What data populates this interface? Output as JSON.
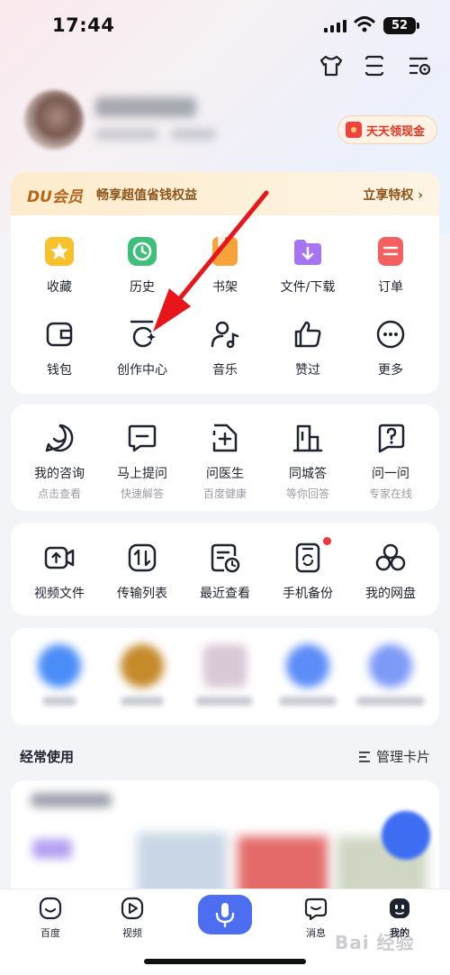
{
  "status": {
    "time": "17:44",
    "battery": "52"
  },
  "profile": {
    "cash_label": "天天领现金"
  },
  "vip": {
    "logo": "DU会员",
    "text": "畅享超值省钱权益",
    "link": "立享特权 ›"
  },
  "quick_grid": [
    {
      "label": "收藏",
      "icon": "star-icon",
      "color": "#f6c12b"
    },
    {
      "label": "历史",
      "icon": "clock-icon",
      "color": "#3ec07b"
    },
    {
      "label": "书架",
      "icon": "bookshelf-icon",
      "color": "#f7a33b"
    },
    {
      "label": "文件/下载",
      "icon": "download-folder-icon",
      "color": "#a775f3"
    },
    {
      "label": "订单",
      "icon": "order-icon",
      "color": "#f45f5f"
    },
    {
      "label": "钱包",
      "icon": "wallet-icon"
    },
    {
      "label": "创作中心",
      "icon": "creation-icon"
    },
    {
      "label": "音乐",
      "icon": "music-icon"
    },
    {
      "label": "赞过",
      "icon": "thumbs-up-icon"
    },
    {
      "label": "更多",
      "icon": "more-icon"
    }
  ],
  "consult": [
    {
      "label": "我的咨询",
      "sub": "点击查看",
      "icon": "chat-smile-icon"
    },
    {
      "label": "马上提问",
      "sub": "快速解答",
      "icon": "ask-icon"
    },
    {
      "label": "问医生",
      "sub": "百度健康",
      "icon": "doctor-icon"
    },
    {
      "label": "同城答",
      "sub": "等你回答",
      "icon": "building-icon"
    },
    {
      "label": "问一问",
      "sub": "专家在线",
      "icon": "question-icon"
    }
  ],
  "tools": [
    {
      "label": "视频文件",
      "icon": "video-file-icon"
    },
    {
      "label": "传输列表",
      "icon": "transfer-icon"
    },
    {
      "label": "最近查看",
      "icon": "recent-icon"
    },
    {
      "label": "手机备份",
      "icon": "phone-backup-icon"
    },
    {
      "label": "我的网盘",
      "icon": "cloud-drive-icon"
    }
  ],
  "frequent": {
    "title": "经常使用",
    "manage": "管理卡片"
  },
  "tabbar": [
    {
      "label": "百度",
      "icon": "baidu-home-icon"
    },
    {
      "label": "视频",
      "icon": "video-play-icon"
    },
    {
      "label": "",
      "icon": "microphone-icon"
    },
    {
      "label": "消息",
      "icon": "message-icon"
    },
    {
      "label": "我的",
      "icon": "me-icon"
    }
  ],
  "watermark": "Bai 经验"
}
